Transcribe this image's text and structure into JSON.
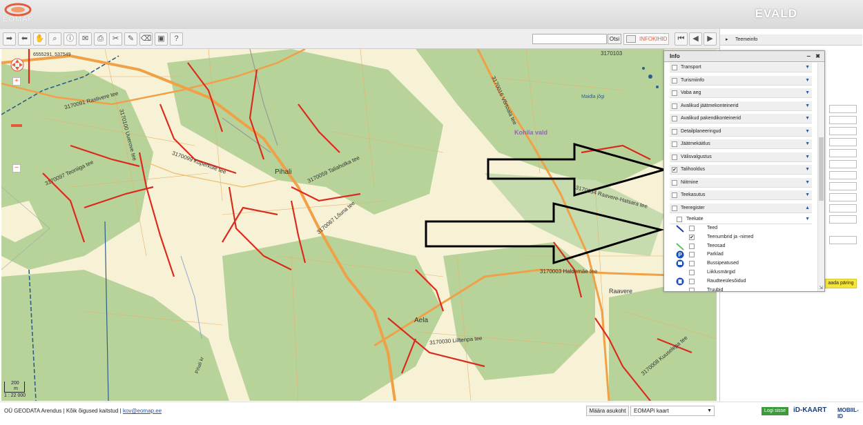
{
  "header": {
    "logo_text": "EOMAP",
    "brand": "EVALD"
  },
  "toolbar": {
    "icons": [
      "forward-icon",
      "back-icon",
      "pan-hand-icon",
      "zoom-icon",
      "info-icon",
      "mail-icon",
      "print-icon",
      "scissors-icon",
      "draw-icon",
      "eraser-icon",
      "image-icon",
      "help-icon"
    ],
    "help_label": "?",
    "search_placeholder": "",
    "search_button": "Otsi",
    "infokihid_label": "INFOKIHID"
  },
  "map": {
    "coordinates": "6555291, 537549",
    "scale_text": "1 : 22 000",
    "scale_bar_value": "200",
    "scale_bar_unit": "m",
    "place_labels": [
      "Pihali",
      "Aela",
      "Kohila vald",
      "Raavere",
      "Maidla jõgi",
      "Pihali kr"
    ],
    "road_labels": [
      "3170091 Rastivere tee",
      "3170100 Uuerove tee",
      "3170097 Teoniiga tee",
      "3170099 Kuperkule tee",
      "3170067 Lõuna tee",
      "3170059 Taliaholka tee",
      "3170016 Võrtoala tee",
      "3170003 Haldemäe tee",
      "3170030 Liiltenpa tee",
      "3170054 Raavere-Hatsara tee",
      "3170008 Kuuselepa tee",
      "3170103"
    ]
  },
  "right_panel": {
    "header": "Teemeinfo",
    "query_button": "aada päring"
  },
  "info_panel": {
    "title": "Info",
    "minimize": "–",
    "close": "✖",
    "layers": [
      {
        "label": "Transport",
        "checked": false
      },
      {
        "label": "Turismiinfo",
        "checked": false
      },
      {
        "label": "Vaba aeg",
        "checked": false
      },
      {
        "label": "Avalikud jäätmekonteinerid",
        "checked": false
      },
      {
        "label": "Avalikud pakendikonteinerid",
        "checked": false
      },
      {
        "label": "Detailplaneeringud",
        "checked": false
      },
      {
        "label": "Jäätmekäitlus",
        "checked": false
      },
      {
        "label": "Välisvalgustus",
        "checked": false
      },
      {
        "label": "Talihooldus",
        "checked": true
      },
      {
        "label": "Niitmine",
        "checked": false
      },
      {
        "label": "Teekasutus",
        "checked": false
      },
      {
        "label": "Teeregister",
        "checked": false
      }
    ],
    "sublayer_group": {
      "label": "Teekate",
      "checked": false
    },
    "sublayers": [
      {
        "label": "Teed",
        "checked": false,
        "symbol": "road-line-icon"
      },
      {
        "label": "Teenumbrid ja -nimed",
        "checked": true,
        "symbol": ""
      },
      {
        "label": "Teeosad",
        "checked": false,
        "symbol": "road-part-icon"
      },
      {
        "label": "Parklad",
        "checked": false,
        "symbol": "parking-icon"
      },
      {
        "label": "Bussipeatused",
        "checked": false,
        "symbol": "bus-stop-icon"
      },
      {
        "label": "Liiklusmärgid",
        "checked": false,
        "symbol": ""
      },
      {
        "label": "Raudteeülesõidud",
        "checked": false,
        "symbol": "railway-crossing-icon"
      },
      {
        "label": "Truubid",
        "checked": false,
        "symbol": ""
      }
    ],
    "parking_symbol": "P"
  },
  "footer": {
    "copyright_text": "OÜ GEODATA Arendus | Kõik õigused kaitstud |",
    "email": "kov@eomap.ee",
    "locate_button": "Määra asukoht",
    "map_type": "EOMAPi kaart",
    "login_button": "Logi sisse",
    "idkaart": "iD-KAART",
    "mobiil": "MOBIIL-ID"
  },
  "colors": {
    "forest": "#b7d39a",
    "field": "#f7f1d6",
    "highlight_road": "#d92b1e",
    "main_road": "#f0a046",
    "accent": "#e25b3a"
  }
}
